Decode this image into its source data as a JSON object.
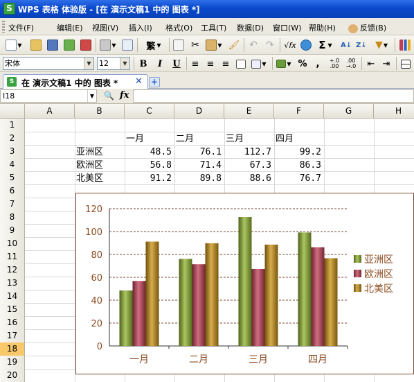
{
  "window": {
    "title": "WPS 表格 体验版 - [在 演示文稿1 中的 图表 *]"
  },
  "menu": [
    {
      "label": "文件(F)"
    },
    {
      "label": "编辑(E)"
    },
    {
      "label": "视图(V)"
    },
    {
      "label": "插入(I)"
    },
    {
      "label": "格式(O)"
    },
    {
      "label": "工具(T)"
    },
    {
      "label": "数据(D)"
    },
    {
      "label": "窗口(W)"
    },
    {
      "label": "帮助(H)"
    },
    {
      "label": "反馈(B)"
    }
  ],
  "toolbar": {
    "font_name": "宋体",
    "font_size": "12",
    "sigma": "Σ",
    "bold": "B",
    "italic": "I",
    "underline": "U",
    "percent": "%",
    "comma": ","
  },
  "tabs": [
    {
      "label": "在 演示文稿1 中的 图表 *"
    }
  ],
  "formula_bar": {
    "name_box": "I18",
    "fx": "fx",
    "formula": ""
  },
  "grid": {
    "columns": [
      "A",
      "B",
      "C",
      "D",
      "E",
      "F",
      "G",
      "H"
    ],
    "rows": [
      "1",
      "2",
      "3",
      "4",
      "5",
      "6",
      "7",
      "8",
      "9",
      "10",
      "11",
      "12",
      "13",
      "14",
      "15",
      "16",
      "17",
      "18",
      "19",
      "20"
    ],
    "selected_row": "18",
    "header_row": [
      "一月",
      "二月",
      "三月",
      "四月"
    ],
    "data_rows": [
      {
        "label": "亚洲区",
        "values": [
          "48.5",
          "76.1",
          "112.7",
          "99.2"
        ]
      },
      {
        "label": "欧洲区",
        "values": [
          "56.8",
          "71.4",
          "67.3",
          "86.3"
        ]
      },
      {
        "label": "北美区",
        "values": [
          "91.2",
          "89.8",
          "88.6",
          "76.7"
        ]
      }
    ]
  },
  "chart_data": {
    "type": "bar",
    "categories": [
      "一月",
      "二月",
      "三月",
      "四月"
    ],
    "series": [
      {
        "name": "亚洲区",
        "values": [
          48.5,
          76.1,
          112.7,
          99.2
        ],
        "color": "#8fb32e"
      },
      {
        "name": "欧洲区",
        "values": [
          56.8,
          71.4,
          67.3,
          86.3
        ],
        "color": "#c23e55"
      },
      {
        "name": "北美区",
        "values": [
          91.2,
          89.8,
          88.6,
          76.7
        ],
        "color": "#c99212"
      }
    ],
    "ylim": [
      0,
      120
    ],
    "yticks": [
      "0",
      "20",
      "40",
      "60",
      "80",
      "100",
      "120"
    ],
    "grid": true,
    "legend": "right",
    "title": "",
    "xlabel": "",
    "ylabel": "",
    "text_color": "#8a4a1f"
  }
}
